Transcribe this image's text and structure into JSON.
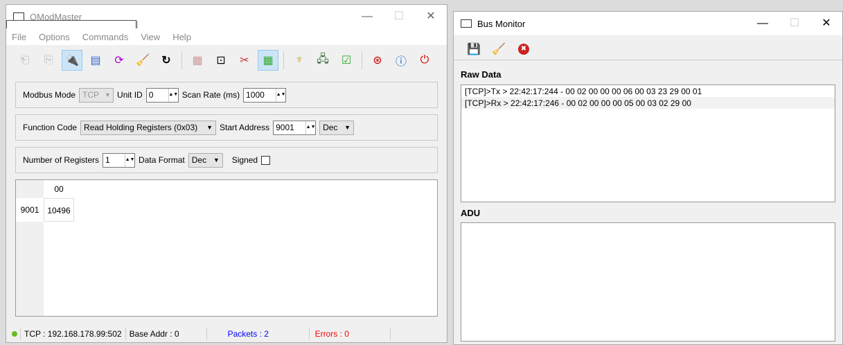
{
  "qmodmaster": {
    "title": "QModMaster",
    "menu": [
      "File",
      "Options",
      "Commands",
      "View",
      "Help"
    ],
    "toolbar_icons": [
      "load-session-icon",
      "save-session-icon",
      "connect-icon",
      "read-write-icon",
      "scan-icon",
      "clear-icon",
      "reset-icon",
      "log-icon",
      "bus-monitor-icon",
      "tools-icon",
      "table-icon",
      "rtu-icon",
      "tcp-icon",
      "settings-icon",
      "help-icon",
      "about-icon",
      "exit-icon"
    ],
    "modbus_mode_label": "Modbus Mode",
    "modbus_mode": "TCP",
    "unit_id_label": "Unit ID",
    "unit_id": "0",
    "scan_rate_label": "Scan Rate (ms)",
    "scan_rate": "1000",
    "function_code_label": "Function Code",
    "function_code": "Read Holding Registers (0x03)",
    "start_address_label": "Start Address",
    "start_address": "9001",
    "address_format": "Dec",
    "num_registers_label": "Number of Registers",
    "num_registers": "1",
    "data_format_label": "Data Format",
    "data_format": "Dec",
    "signed_label": "Signed",
    "table": {
      "column": "00",
      "row_header": "9001",
      "value": "10496"
    },
    "status": {
      "connection": "TCP : 192.168.178.99:502",
      "base_addr": "Base Addr : 0",
      "packets": "Packets : 2",
      "errors": "Errors : 0"
    },
    "colors": {
      "packets": "#0000ff",
      "errors": "#ff0000",
      "led": "#66bb22"
    }
  },
  "bus_monitor": {
    "title": "Bus Monitor",
    "raw_data_label": "Raw Data",
    "raw_lines": [
      "[TCP]>Tx > 22:42:17:244 - 00  02  00  00  00  06  00  03  23  29  00  01",
      "[TCP]>Rx > 22:42:17:246 - 00  02  00  00  00  05  00  03  02  29  00"
    ],
    "adu_label": "ADU"
  }
}
